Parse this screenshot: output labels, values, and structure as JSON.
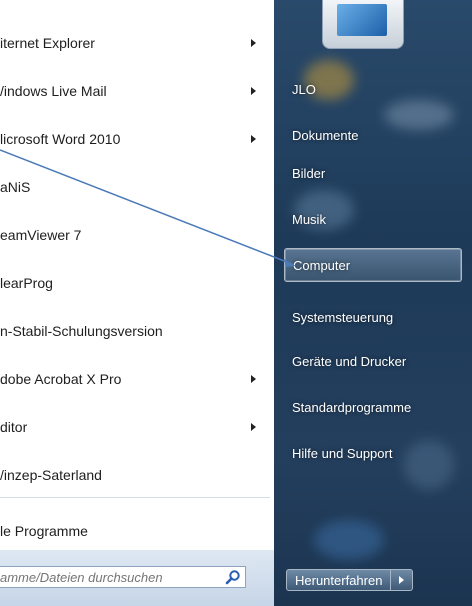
{
  "programs": [
    {
      "label": "iternet Explorer",
      "arrow": true
    },
    {
      "label": "/indows Live Mail",
      "arrow": true
    },
    {
      "label": "licrosoft Word 2010",
      "arrow": true
    },
    {
      "label": "aNiS",
      "arrow": false
    },
    {
      "label": "eamViewer 7",
      "arrow": false
    },
    {
      "label": "learProg",
      "arrow": false
    },
    {
      "label": "n-Stabil-Schulungsversion",
      "arrow": false
    },
    {
      "label": "dobe Acrobat X Pro",
      "arrow": true
    },
    {
      "label": "ditor",
      "arrow": true
    },
    {
      "label": "/inzep-Saterland",
      "arrow": false
    }
  ],
  "all_programs_label": "le Programme",
  "search": {
    "placeholder": "amme/Dateien durchsuchen",
    "icon": "search-icon"
  },
  "right_items": [
    {
      "label": "JLO",
      "highlight": false
    },
    {
      "label": "Dokumente",
      "highlight": false
    },
    {
      "label": "Bilder",
      "highlight": false
    },
    {
      "label": "Musik",
      "highlight": false
    },
    {
      "label": "Computer",
      "highlight": true
    },
    {
      "label": "Systemsteuerung",
      "highlight": false
    },
    {
      "label": "Geräte und Drucker",
      "highlight": false
    },
    {
      "label": "Standardprogramme",
      "highlight": false
    },
    {
      "label": "Hilfe und Support",
      "highlight": false
    }
  ],
  "shutdown_label": "Herunterfahren",
  "colors": {
    "annotation_line": "#4a7ab8",
    "panel_dark": "#1d3a58"
  }
}
